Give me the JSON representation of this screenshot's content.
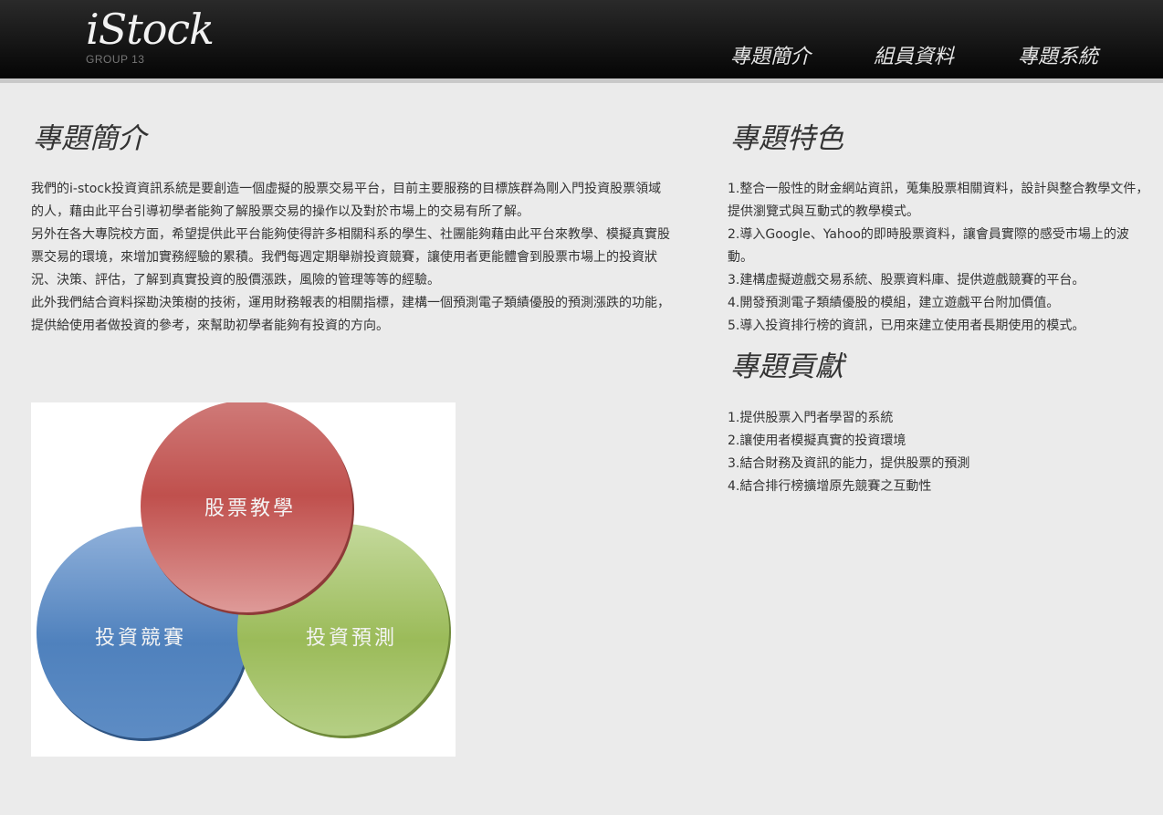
{
  "header": {
    "logo_title": "iStock",
    "logo_subtitle": "GROUP 13",
    "nav": [
      "專題簡介",
      "組員資料",
      "專題系統"
    ]
  },
  "intro": {
    "title": "專題簡介",
    "paragraphs": [
      "我們的i-stock投資資訊系統是要創造一個虛擬的股票交易平台，目前主要服務的目標族群為剛入門投資股票領域的人，藉由此平台引導初學者能夠了解股票交易的操作以及對於市場上的交易有所了解。",
      "另外在各大專院校方面，希望提供此平台能夠使得許多相關科系的學生、社團能夠藉由此平台來教學、模擬真實股票交易的環境，來增加實務經驗的累積。我們每週定期舉辦投資競賽，讓使用者更能體會到股票市場上的投資狀況、決策、評估，了解到真實投資的股價漲跌，風險的管理等等的經驗。",
      "此外我們結合資料探勘決策樹的技術，運用財務報表的相關指標，建構一個預測電子類績優股的預測漲跌的功能，提供給使用者做投資的參考，來幫助初學者能夠有投資的方向。"
    ]
  },
  "diagram": {
    "circles": [
      {
        "label": "股票教學",
        "color": "#c0504d"
      },
      {
        "label": "投資競賽",
        "color": "#4f81bd"
      },
      {
        "label": "投資預測",
        "color": "#9bbb59"
      }
    ]
  },
  "features": {
    "title": "專題特色",
    "items": [
      "1.整合一般性的財金網站資訊，蒐集股票相關資料，設計與整合教學文件，提供瀏覽式與互動式的教學模式。",
      "2.導入Google、Yahoo的即時股票資料，讓會員實際的感受市場上的波動。",
      "3.建構虛擬遊戲交易系統、股票資料庫、提供遊戲競賽的平台。",
      "4.開發預測電子類績優股的模組，建立遊戲平台附加價值。",
      "5.導入投資排行榜的資訊，已用來建立使用者長期使用的模式。"
    ]
  },
  "contributions": {
    "title": "專題貢獻",
    "items": [
      "1.提供股票入門者學習的系統",
      "2.讓使用者模擬真實的投資環境",
      "3.結合財務及資訊的能力，提供股票的預測",
      "4.結合排行榜擴增原先競賽之互動性"
    ]
  }
}
